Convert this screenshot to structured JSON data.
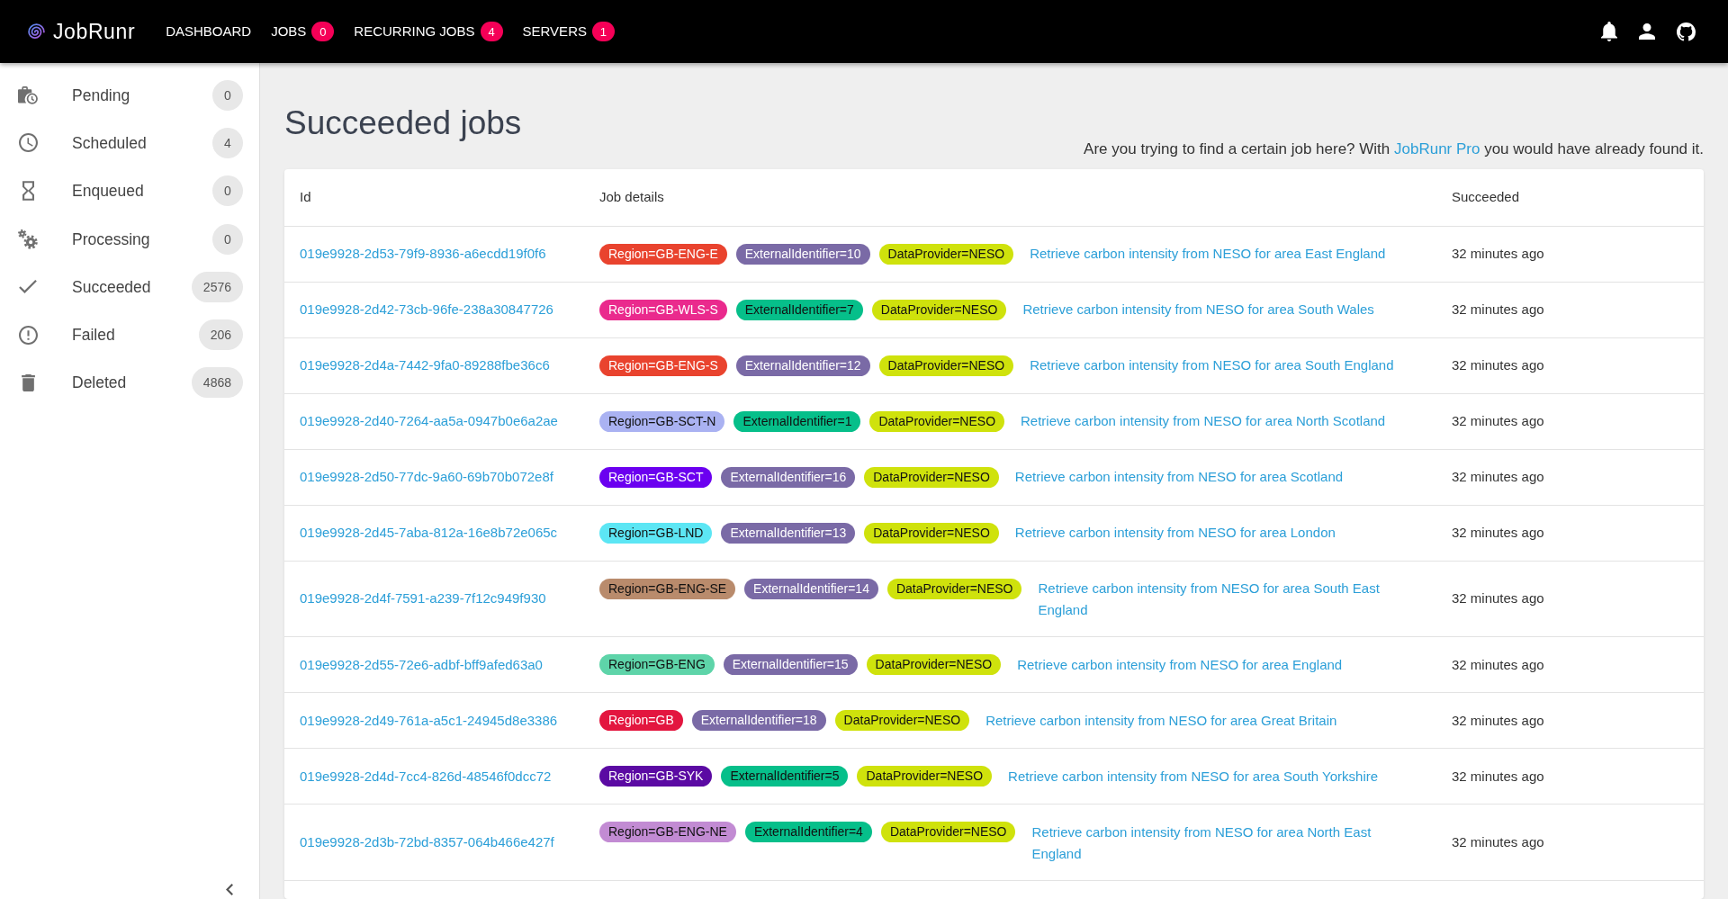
{
  "top_bar": {
    "logo_text": "JobRunr",
    "nav": [
      {
        "label": "DASHBOARD"
      },
      {
        "label": "JOBS",
        "count": "0"
      },
      {
        "label": "RECURRING JOBS",
        "count": "4"
      },
      {
        "label": "SERVERS",
        "count": "1"
      }
    ]
  },
  "sidebar": {
    "items": [
      {
        "kind": "pending",
        "label": "Pending",
        "count": "0"
      },
      {
        "kind": "scheduled",
        "label": "Scheduled",
        "count": "4"
      },
      {
        "kind": "enqueued",
        "label": "Enqueued",
        "count": "0"
      },
      {
        "kind": "processing",
        "label": "Processing",
        "count": "0"
      },
      {
        "kind": "succeeded",
        "label": "Succeeded",
        "count": "2576"
      },
      {
        "kind": "failed",
        "label": "Failed",
        "count": "206"
      },
      {
        "kind": "deleted",
        "label": "Deleted",
        "count": "4868"
      }
    ]
  },
  "page": {
    "title": "Succeeded jobs",
    "promo": {
      "before": "Are you trying to find a certain job here? With ",
      "link": "JobRunr Pro",
      "after": " you would have already found it."
    }
  },
  "table": {
    "columns": [
      "Id",
      "Job details",
      "Succeeded"
    ],
    "rows": [
      {
        "id": "019e9928-2d53-79f9-8936-a6ecdd19f0f6",
        "tags": [
          {
            "label": "Region=GB-ENG-E",
            "color": "#e9432e"
          },
          {
            "label": "ExternalIdentifier=10",
            "color": "#7a6aa6"
          },
          {
            "label": "DataProvider=NESO",
            "color": "#cfe20c"
          }
        ],
        "description": "Retrieve carbon intensity from NESO for area East England",
        "succeeded": "32 minutes ago"
      },
      {
        "id": "019e9928-2d42-73cb-96fe-238a30847726",
        "tags": [
          {
            "label": "Region=GB-WLS-S",
            "color": "#ea2a8d"
          },
          {
            "label": "ExternalIdentifier=7",
            "color": "#06bf8a"
          },
          {
            "label": "DataProvider=NESO",
            "color": "#cfe20c"
          }
        ],
        "description": "Retrieve carbon intensity from NESO for area South Wales",
        "succeeded": "32 minutes ago"
      },
      {
        "id": "019e9928-2d4a-7442-9fa0-89288fbe36c6",
        "tags": [
          {
            "label": "Region=GB-ENG-S",
            "color": "#e9432e"
          },
          {
            "label": "ExternalIdentifier=12",
            "color": "#7a6aa6"
          },
          {
            "label": "DataProvider=NESO",
            "color": "#cfe20c"
          }
        ],
        "description": "Retrieve carbon intensity from NESO for area South England",
        "succeeded": "32 minutes ago"
      },
      {
        "id": "019e9928-2d40-7264-aa5a-0947b0e6a2ae",
        "tags": [
          {
            "label": "Region=GB-SCT-N",
            "color": "#aab2f2"
          },
          {
            "label": "ExternalIdentifier=1",
            "color": "#06bf8a"
          },
          {
            "label": "DataProvider=NESO",
            "color": "#cfe20c"
          }
        ],
        "description": "Retrieve carbon intensity from NESO for area North Scotland",
        "succeeded": "32 minutes ago"
      },
      {
        "id": "019e9928-2d50-77dc-9a60-69b70b072e8f",
        "tags": [
          {
            "label": "Region=GB-SCT",
            "color": "#6b00f0"
          },
          {
            "label": "ExternalIdentifier=16",
            "color": "#7a6aa6"
          },
          {
            "label": "DataProvider=NESO",
            "color": "#cfe20c"
          }
        ],
        "description": "Retrieve carbon intensity from NESO for area Scotland",
        "succeeded": "32 minutes ago"
      },
      {
        "id": "019e9928-2d45-7aba-812a-16e8b72e065c",
        "tags": [
          {
            "label": "Region=GB-LND",
            "color": "#5ce6f4"
          },
          {
            "label": "ExternalIdentifier=13",
            "color": "#7a6aa6"
          },
          {
            "label": "DataProvider=NESO",
            "color": "#cfe20c"
          }
        ],
        "description": "Retrieve carbon intensity from NESO for area London",
        "succeeded": "32 minutes ago"
      },
      {
        "id": "019e9928-2d4f-7591-a239-7f12c949f930",
        "tags": [
          {
            "label": "Region=GB-ENG-SE",
            "color": "#b98b6c"
          },
          {
            "label": "ExternalIdentifier=14",
            "color": "#7a6aa6"
          },
          {
            "label": "DataProvider=NESO",
            "color": "#cfe20c"
          }
        ],
        "description": "Retrieve carbon intensity from NESO for area South East England",
        "succeeded": "32 minutes ago"
      },
      {
        "id": "019e9928-2d55-72e6-adbf-bff9afed63a0",
        "tags": [
          {
            "label": "Region=GB-ENG",
            "color": "#5ed4a9"
          },
          {
            "label": "ExternalIdentifier=15",
            "color": "#7a6aa6"
          },
          {
            "label": "DataProvider=NESO",
            "color": "#cfe20c"
          }
        ],
        "description": "Retrieve carbon intensity from NESO for area England",
        "succeeded": "32 minutes ago"
      },
      {
        "id": "019e9928-2d49-761a-a5c1-24945d8e3386",
        "tags": [
          {
            "label": "Region=GB",
            "color": "#e3163f"
          },
          {
            "label": "ExternalIdentifier=18",
            "color": "#7a6aa6"
          },
          {
            "label": "DataProvider=NESO",
            "color": "#cfe20c"
          }
        ],
        "description": "Retrieve carbon intensity from NESO for area Great Britain",
        "succeeded": "32 minutes ago"
      },
      {
        "id": "019e9928-2d4d-7cc4-826d-48546f0dcc72",
        "tags": [
          {
            "label": "Region=GB-SYK",
            "color": "#5b0aa3"
          },
          {
            "label": "ExternalIdentifier=5",
            "color": "#06bf8a"
          },
          {
            "label": "DataProvider=NESO",
            "color": "#cfe20c"
          }
        ],
        "description": "Retrieve carbon intensity from NESO for area South Yorkshire",
        "succeeded": "32 minutes ago"
      },
      {
        "id": "019e9928-2d3b-72bd-8357-064b466e427f",
        "tags": [
          {
            "label": "Region=GB-ENG-NE",
            "color": "#c28bd3"
          },
          {
            "label": "ExternalIdentifier=4",
            "color": "#06bf8a"
          },
          {
            "label": "DataProvider=NESO",
            "color": "#cfe20c"
          }
        ],
        "description": "Retrieve carbon intensity from NESO for area North East England",
        "succeeded": "32 minutes ago"
      }
    ]
  }
}
